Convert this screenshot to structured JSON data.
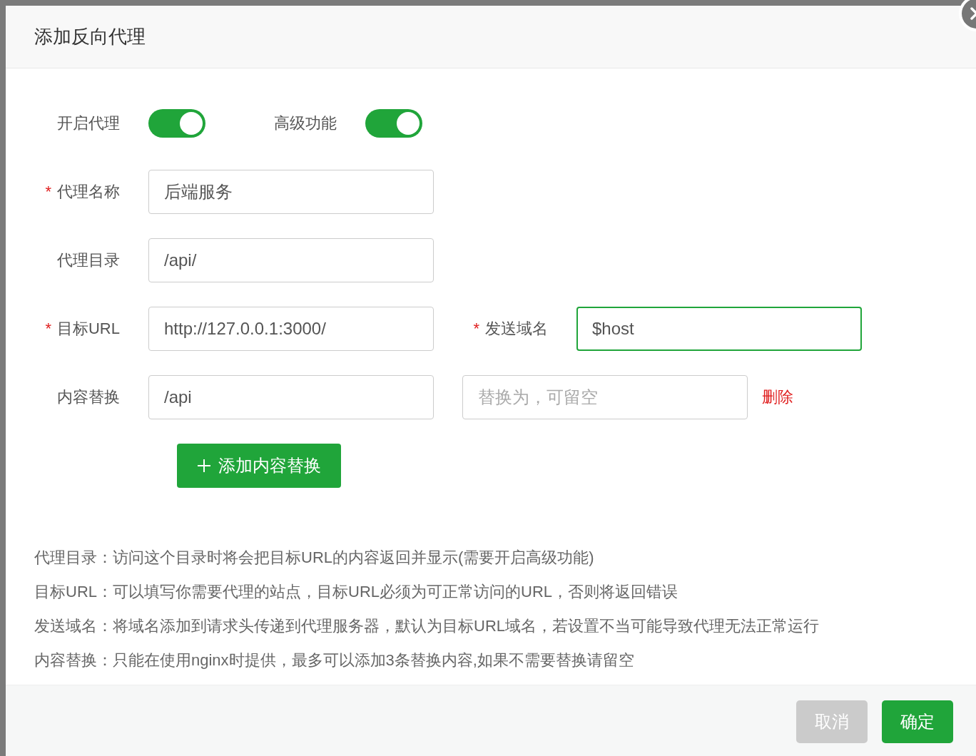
{
  "dialog": {
    "title": "添加反向代理"
  },
  "form": {
    "rows": [
      {
        "kind": "toggles",
        "items": [
          {
            "label": "开启代理",
            "on": true
          },
          {
            "label": "高级功能",
            "on": true
          }
        ]
      },
      {
        "kind": "field",
        "required_mark": "*",
        "label": "代理名称",
        "input": {
          "value": "后端服务",
          "focused": false
        }
      },
      {
        "kind": "field",
        "label": "代理目录",
        "input": {
          "value": "/api/",
          "focused": false
        }
      },
      {
        "kind": "field",
        "required_mark": "*",
        "label": "目标URL",
        "input": {
          "value": "http://127.0.0.1:3000/",
          "focused": false
        },
        "second": {
          "required_mark": "*",
          "label": "发送域名",
          "input": {
            "value": "$host",
            "focused": true
          }
        }
      },
      {
        "kind": "replace",
        "label": "内容替换",
        "input": {
          "value": "/api",
          "focused": false
        },
        "replacement": {
          "placeholder": "替换为，可留空",
          "focused": false
        },
        "delete": "删除"
      },
      {
        "kind": "button",
        "label": "添加内容替换"
      }
    ]
  },
  "notes": [
    "代理目录：访问这个目录时将会把目标URL的内容返回并显示(需要开启高级功能)",
    "目标URL：可以填写你需要代理的站点，目标URL必须为可正常访问的URL，否则将返回错误",
    "发送域名：将域名添加到请求头传递到代理服务器，默认为目标URL域名，若设置不当可能导致代理无法正常运行",
    "内容替换：只能在使用nginx时提供，最多可以添加3条替换内容,如果不需要替换请留空"
  ],
  "footer": {
    "buttons": [
      {
        "kind": "cancel",
        "label": "取消"
      },
      {
        "kind": "primary",
        "label": "确定"
      }
    ]
  }
}
